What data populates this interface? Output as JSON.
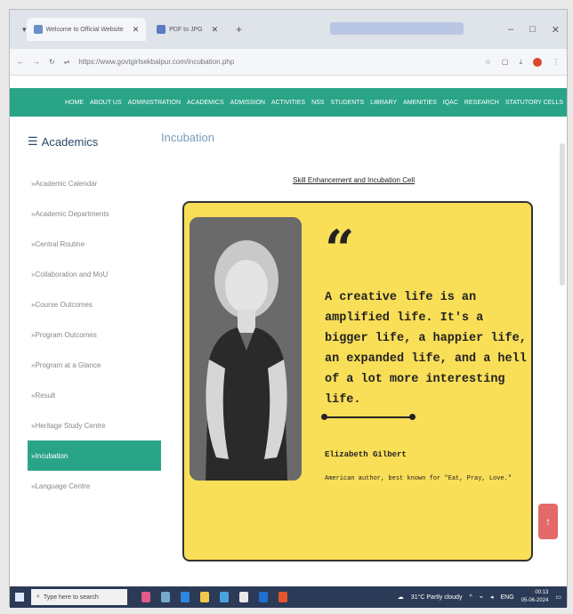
{
  "browser": {
    "tabs": [
      {
        "title": "Welcome to Official Website",
        "active": true
      },
      {
        "title": "PDF to JPG",
        "active": false
      }
    ],
    "url": "https://www.govtgirlsekbalpur.com/incubation.php"
  },
  "nav": {
    "items": [
      "HOME",
      "ABOUT US",
      "ADMINISTRATION",
      "ACADEMICS",
      "ADMISSION",
      "ACTIVITIES",
      "NSS",
      "STUDENTS",
      "LIBRARY",
      "AMENITIES",
      "IQAC",
      "RESEARCH",
      "STATUTORY CELLS"
    ]
  },
  "sidebar": {
    "title": "Academics",
    "items": [
      {
        "label": "Academic Calendar"
      },
      {
        "label": "Academic Departments"
      },
      {
        "label": "Central Routine"
      },
      {
        "label": "Collaboration and MoU"
      },
      {
        "label": "Course Outcomes"
      },
      {
        "label": "Program Outcomes"
      },
      {
        "label": "Program at a Glance"
      },
      {
        "label": "Result"
      },
      {
        "label": "Heritage Study Centre"
      },
      {
        "label": "Incubation",
        "active": true
      },
      {
        "label": "Language Centre"
      }
    ]
  },
  "main": {
    "heading": "Incubation",
    "section_title": "Skill Enhancement and Incubation Cell",
    "quote": {
      "mark": "“",
      "text": "A creative life is an amplified life. It's a bigger life, a happier life, an expanded life, and a hell of a lot more interesting life.",
      "author": "Elizabeth Gilbert",
      "author_desc": "American author, best known for \"Eat, Pray, Love.\""
    }
  },
  "taskbar": {
    "search_placeholder": "Type here to search",
    "weather": "31°C Partly cloudy",
    "lang": "ENG",
    "time": "00:13",
    "date": "05-06-2024"
  },
  "colors": {
    "nav_green": "#2aa487",
    "card_yellow": "#f9de58",
    "scroll_top_red": "#e46a6a"
  }
}
